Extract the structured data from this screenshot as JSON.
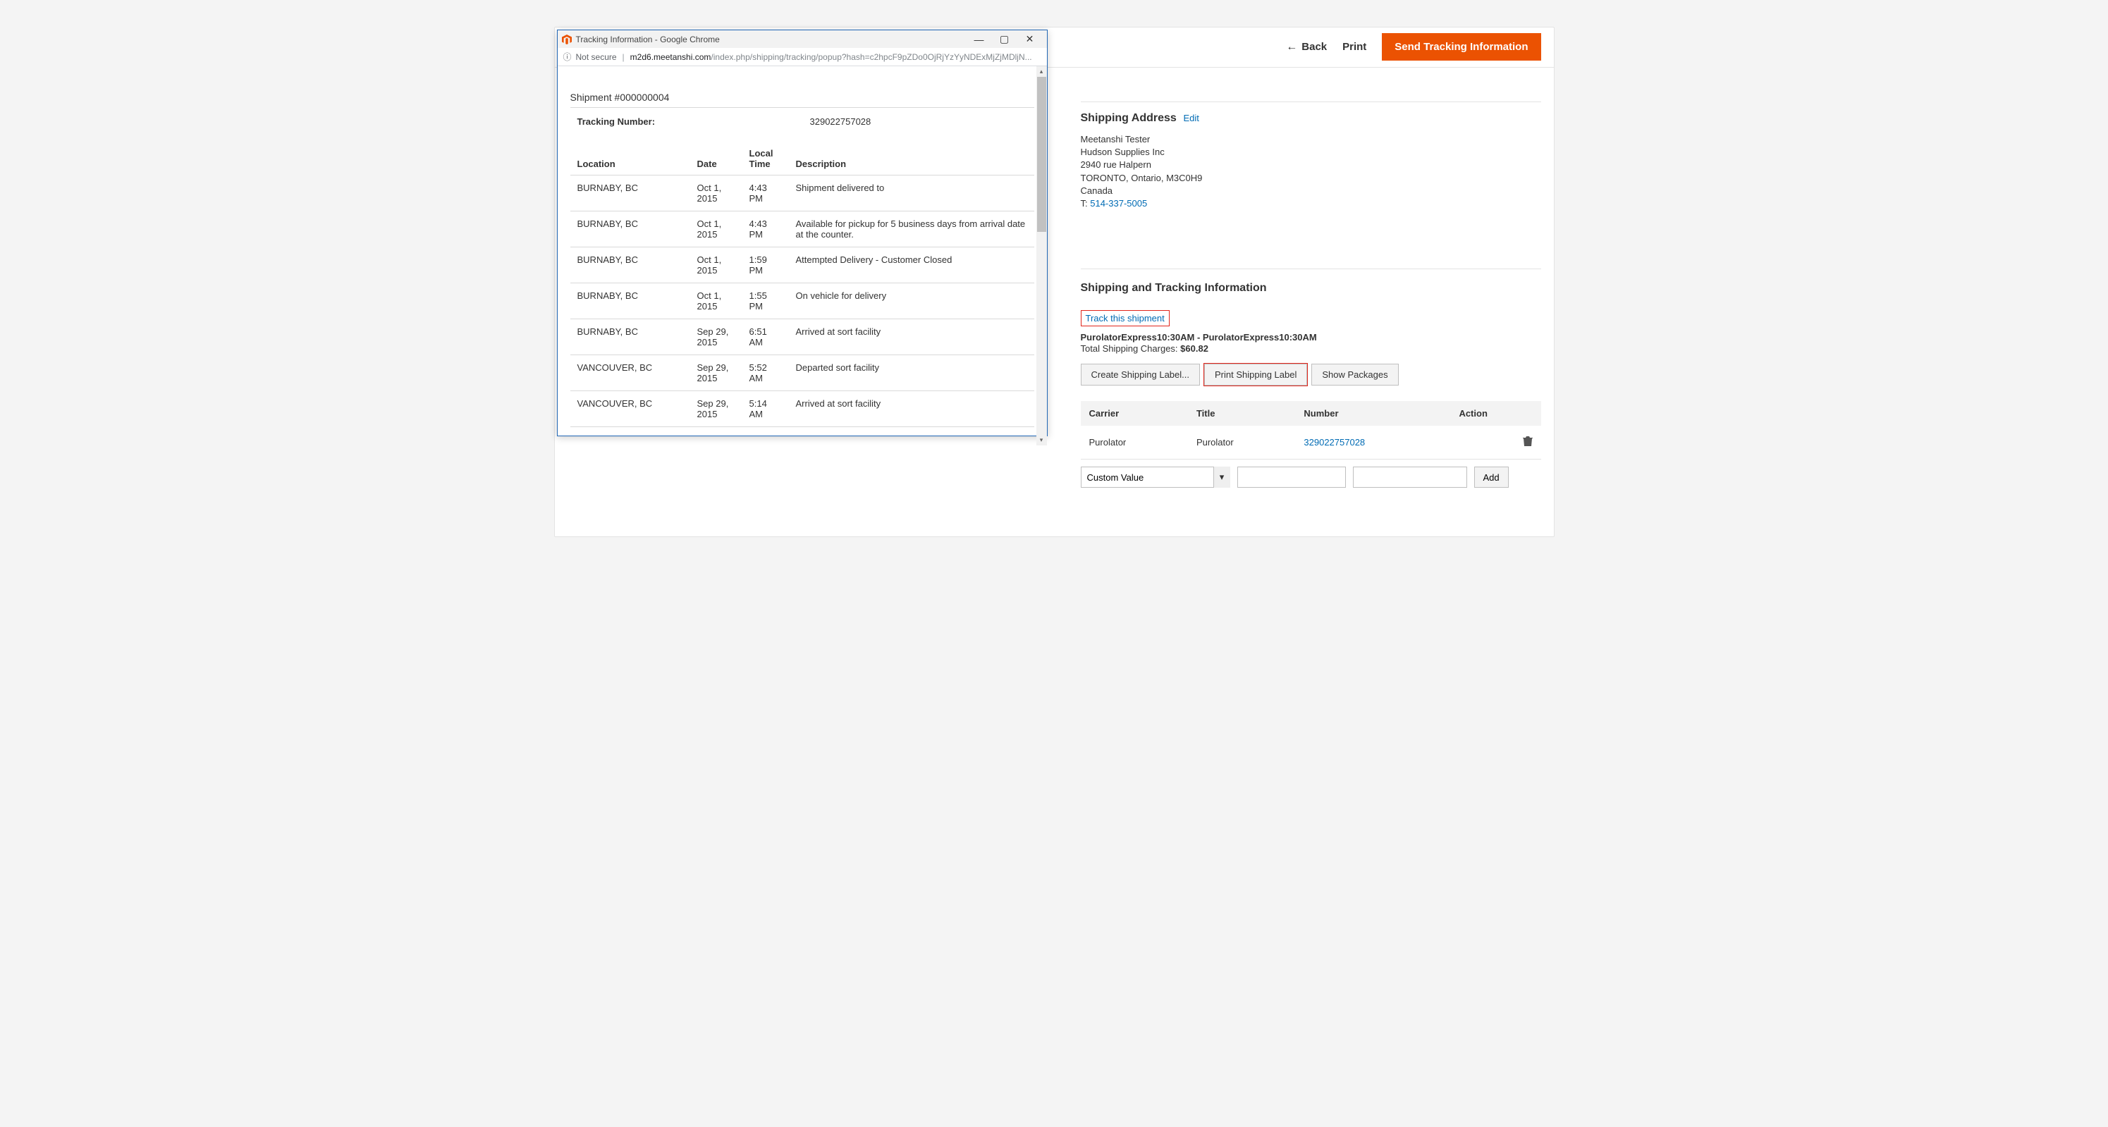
{
  "topbar": {
    "back": "Back",
    "print": "Print",
    "send": "Send Tracking Information"
  },
  "shipping_address": {
    "title": "Shipping Address",
    "edit": "Edit",
    "name": "Meetanshi Tester",
    "company": "Hudson Supplies Inc",
    "street": "2940 rue Halpern",
    "city_line": "TORONTO, Ontario, M3C0H9",
    "country": "Canada",
    "phone_prefix": "T: ",
    "phone": "514-337-5005"
  },
  "tracking": {
    "title": "Shipping and Tracking Information",
    "track_link": "Track this shipment",
    "method": "PurolatorExpress10:30AM - PurolatorExpress10:30AM",
    "charges_label": "Total Shipping Charges: ",
    "charges_amount": "$60.82",
    "buttons": {
      "create": "Create Shipping Label...",
      "print_label": "Print Shipping Label",
      "show_packages": "Show Packages"
    },
    "headers": {
      "carrier": "Carrier",
      "title": "Title",
      "number": "Number",
      "action": "Action"
    },
    "row": {
      "carrier": "Purolator",
      "title": "Purolator",
      "number": "329022757028"
    },
    "add": {
      "select": "Custom Value",
      "button": "Add"
    }
  },
  "popup": {
    "title": "Tracking Information - Google Chrome",
    "not_secure": "Not secure",
    "url_domain": "m2d6.meetanshi.com",
    "url_path": "/index.php/shipping/tracking/popup?hash=c2hpcF9pZDo0OjRjYzYyNDExMjZjMDljN...",
    "shipment_label": "Shipment #000000004",
    "tn_label": "Tracking Number:",
    "tn_value": "329022757028",
    "headers": {
      "location": "Location",
      "date": "Date",
      "local_time": "Local Time",
      "description": "Description"
    },
    "events": [
      {
        "location": "BURNABY, BC",
        "date": "Oct 1, 2015",
        "time": "4:43 PM",
        "desc": "Shipment delivered to"
      },
      {
        "location": "BURNABY, BC",
        "date": "Oct 1, 2015",
        "time": "4:43 PM",
        "desc": "Available for pickup for 5 business days from arrival date at the counter."
      },
      {
        "location": "BURNABY, BC",
        "date": "Oct 1, 2015",
        "time": "1:59 PM",
        "desc": "Attempted Delivery - Customer Closed"
      },
      {
        "location": "BURNABY, BC",
        "date": "Oct 1, 2015",
        "time": "1:55 PM",
        "desc": "On vehicle for delivery"
      },
      {
        "location": "BURNABY, BC",
        "date": "Sep 29, 2015",
        "time": "6:51 AM",
        "desc": "Arrived at sort facility"
      },
      {
        "location": "VANCOUVER, BC",
        "date": "Sep 29, 2015",
        "time": "5:52 AM",
        "desc": "Departed sort facility"
      },
      {
        "location": "VANCOUVER, BC",
        "date": "Sep 29, 2015",
        "time": "5:14 AM",
        "desc": "Arrived at sort facility"
      }
    ]
  }
}
